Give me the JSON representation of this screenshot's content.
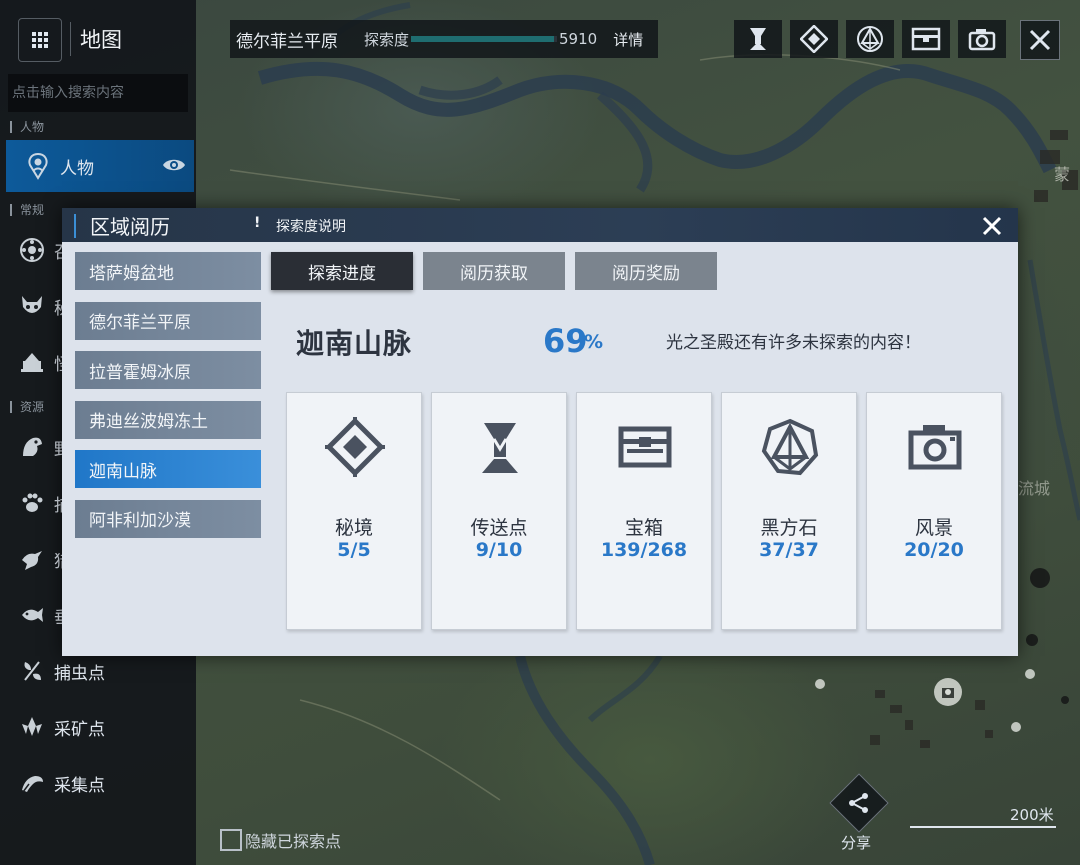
{
  "sidebar": {
    "title": "地图",
    "search_placeholder": "点击输入搜索内容",
    "sections": {
      "person": "人物",
      "common": "常规",
      "resource": "资源"
    },
    "items": [
      {
        "label": "人物",
        "icon": "person-marker-icon"
      },
      {
        "label": "召",
        "icon": "summon-icon"
      },
      {
        "label": "秘",
        "icon": "demon-mask-icon"
      },
      {
        "label": "怪",
        "icon": "monster-icon"
      },
      {
        "label": "野",
        "icon": "wild-beast-icon"
      },
      {
        "label": "捕",
        "icon": "paw-icon"
      },
      {
        "label": "猎",
        "icon": "bird-icon"
      },
      {
        "label": "垂",
        "icon": "fish-icon"
      },
      {
        "label": "捕虫点",
        "icon": "insect-icon"
      },
      {
        "label": "采矿点",
        "icon": "ore-icon"
      },
      {
        "label": "采集点",
        "icon": "herb-icon"
      }
    ]
  },
  "topbar": {
    "region": "德尔菲兰平原",
    "explore_label": "探索度",
    "explore_value": "5910",
    "detail": "详情"
  },
  "top_icons": [
    "teleport-icon",
    "secret-realm-icon",
    "black-cube-icon",
    "treasure-chest-icon",
    "camera-icon"
  ],
  "bottom": {
    "hide_explored": "隐藏已探索点",
    "share": "分享",
    "scale": "200米"
  },
  "map_labels": {
    "city_fragment": "蒙",
    "river_fragment": "流城"
  },
  "dialog": {
    "title": "区域阅历",
    "info": "探索度说明",
    "regions": [
      {
        "name": "塔萨姆盆地",
        "active": false
      },
      {
        "name": "德尔菲兰平原",
        "active": false
      },
      {
        "name": "拉普霍姆冰原",
        "active": false
      },
      {
        "name": "弗迪丝波姆冻土",
        "active": false
      },
      {
        "name": "迦南山脉",
        "active": true
      },
      {
        "name": "阿非利加沙漠",
        "active": false
      }
    ],
    "tabs": [
      "探索进度",
      "阅历获取",
      "阅历奖励"
    ],
    "current_region": "迦南山脉",
    "percent": "69",
    "percent_sign": "%",
    "hint": "光之圣殿还有许多未探索的内容！",
    "cards": [
      {
        "name": "秘境",
        "value": "5/5",
        "icon": "secret-realm-icon"
      },
      {
        "name": "传送点",
        "value": "9/10",
        "icon": "teleport-icon"
      },
      {
        "name": "宝箱",
        "value": "139/268",
        "icon": "treasure-chest-icon"
      },
      {
        "name": "黑方石",
        "value": "37/37",
        "icon": "black-cube-icon"
      },
      {
        "name": "风景",
        "value": "20/20",
        "icon": "camera-icon"
      }
    ]
  },
  "colors": {
    "accent_blue": "#2a78c8",
    "active_blue": "#2077c8",
    "dialog_bg": "#dde3ec"
  }
}
